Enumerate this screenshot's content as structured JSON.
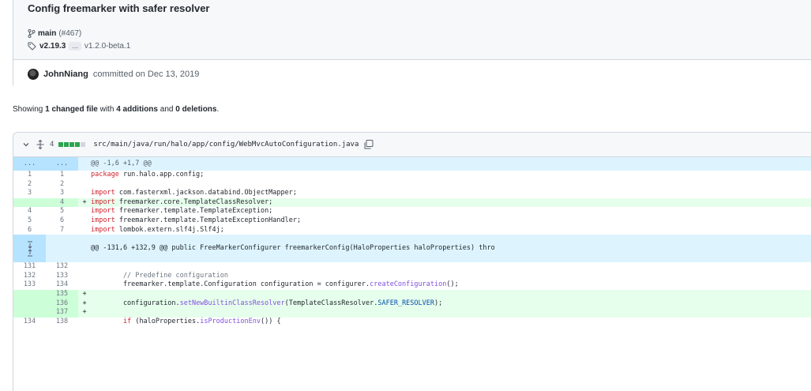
{
  "commit": {
    "title": "Config freemarker with safer resolver",
    "branch": "main",
    "pr": "(#467)",
    "tag_primary": "v2.19.3",
    "tag_ellipsis": "...",
    "tag_secondary": "v1.2.0-beta.1",
    "author": "JohnNiang",
    "committed_text": "committed on Dec 13, 2019"
  },
  "summary": {
    "prefix": "Showing",
    "files": "1 changed file",
    "with": "with",
    "additions": "4 additions",
    "and": "and",
    "deletions": "0 deletions",
    "end": "."
  },
  "file": {
    "count": "4",
    "path": "src/main/java/run/halo/app/config/WebMvcAutoConfiguration.java",
    "bar_fill_fraction": 0.8,
    "icons": [
      "chevron-down-icon",
      "unfold-icon",
      "copy-icon"
    ]
  },
  "diff": {
    "hunk1_left": "...",
    "hunk1_right": "...",
    "hunk1": "@@ -1,6 +1,7 @@",
    "hunk2": "@@ -131,6 +132,9 @@ public FreeMarkerConfigurer freemarkerConfig(HaloProperties haloProperties) thro",
    "lines": [
      {
        "old": "1",
        "new": "1",
        "sign": "",
        "code": "package run.halo.app.config;",
        "type": "ctx"
      },
      {
        "old": "2",
        "new": "2",
        "sign": "",
        "code": "",
        "type": "ctx"
      },
      {
        "old": "3",
        "new": "3",
        "sign": "",
        "code": "import com.fasterxml.jackson.databind.ObjectMapper;",
        "type": "ctx"
      },
      {
        "old": "",
        "new": "4",
        "sign": "+",
        "code": "import freemarker.core.TemplateClassResolver;",
        "type": "add"
      },
      {
        "old": "4",
        "new": "5",
        "sign": "",
        "code": "import freemarker.template.TemplateException;",
        "type": "ctx"
      },
      {
        "old": "5",
        "new": "6",
        "sign": "",
        "code": "import freemarker.template.TemplateExceptionHandler;",
        "type": "ctx"
      },
      {
        "old": "6",
        "new": "7",
        "sign": "",
        "code": "import lombok.extern.slf4j.Slf4j;",
        "type": "ctx"
      }
    ],
    "lines2": [
      {
        "old": "131",
        "new": "132",
        "sign": "",
        "code": "",
        "type": "ctx"
      },
      {
        "old": "132",
        "new": "133",
        "sign": "",
        "code": "        // Predefine configuration",
        "type": "ctx"
      },
      {
        "old": "133",
        "new": "134",
        "sign": "",
        "code": "        freemarker.template.Configuration configuration = configurer.createConfiguration();",
        "type": "ctx"
      },
      {
        "old": "",
        "new": "135",
        "sign": "+",
        "code": "",
        "type": "add"
      },
      {
        "old": "",
        "new": "136",
        "sign": "+",
        "code": "        configuration.setNewBuiltinClassResolver(TemplateClassResolver.SAFER_RESOLVER);",
        "type": "add"
      },
      {
        "old": "",
        "new": "137",
        "sign": "+",
        "code": "",
        "type": "add"
      },
      {
        "old": "134",
        "new": "138",
        "sign": "",
        "code": "        if (haloProperties.isProductionEnv()) {",
        "type": "ctx"
      }
    ]
  }
}
